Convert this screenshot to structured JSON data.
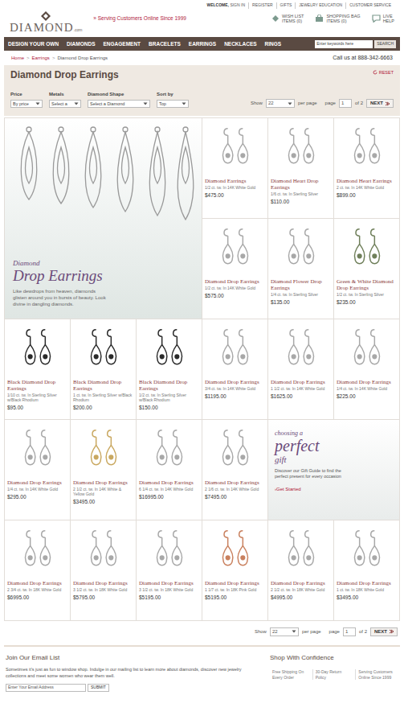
{
  "header": {
    "logo": "DIAMOND",
    "logo_suffix": ".com",
    "tagline": "» Serving Customers Online Since 1999",
    "top_links": [
      {
        "label": "WELCOME,",
        "bold": true,
        "extra": "SIGN IN"
      },
      {
        "label": "REGISTER",
        "bold": false,
        "extra": ""
      },
      {
        "label": "GIFTS",
        "bold": false,
        "extra": ""
      },
      {
        "label": "JEWELRY EDUCATION",
        "bold": false,
        "extra": ""
      },
      {
        "label": "CUSTOMER SERVICE",
        "bold": false,
        "extra": ""
      }
    ],
    "utilities": [
      {
        "label": "WISH LIST",
        "sub": "ITEMS (0)",
        "kind": "wishlist"
      },
      {
        "label": "SHOPPING BAG",
        "sub": "ITEMS (0)",
        "kind": "bag"
      },
      {
        "label": "LIVE",
        "sub": "HELP",
        "kind": "help"
      }
    ]
  },
  "nav": {
    "items": [
      "DESIGN YOUR OWN",
      "DIAMONDS",
      "ENGAGEMENT",
      "BRACELETS",
      "EARRINGS",
      "NECKLACES",
      "RINGS"
    ],
    "search_placeholder": "Enter keywords here",
    "search_button": "SEARCH"
  },
  "breadcrumb": {
    "items": [
      "Home",
      "Earrings",
      "Diamond Drop Earrings"
    ],
    "separator": ">",
    "phone": "Call us at 888-342-6663"
  },
  "page_title": "Diamond Drop Earrings",
  "reset": "RESET",
  "filters": [
    {
      "label": "Price",
      "value": "By price"
    },
    {
      "label": "Metals",
      "value": "Select a"
    },
    {
      "label": "Diamond Shape",
      "value": "Select a Diamond"
    },
    {
      "label": "Sort by",
      "value": "Top"
    }
  ],
  "pagination": {
    "show": "Show",
    "per_page_value": "22",
    "per_page": "per page",
    "page": "page",
    "current": "1",
    "of": "of 2",
    "next": "NEXT"
  },
  "hero": {
    "kicker": "Diamond",
    "title": "Drop Earrings",
    "text": "Like dewdrops from heaven, diamonds glisten around you in bursts of beauty. Look divine in dangling diamonds."
  },
  "promo": {
    "kicker": "choosing a",
    "title": "perfect",
    "title2": "gift",
    "text": "Discover our Gift Guide to find the perfect present for every occasion",
    "link": "›Get Started"
  },
  "products": [
    {
      "name": "Diamond Earrings",
      "desc": "1/2 ct. tw. In 14K White Gold",
      "price": "$475.00",
      "color": "#a8a8a8"
    },
    {
      "name": "Diamond Heart Drop Earrings",
      "desc": "1/6 ct. tw. In Sterling Silver",
      "price": "$110.00",
      "color": "#a8a8a8"
    },
    {
      "name": "Diamond Heart Earrings",
      "desc": "2 ct. tw. In 14K White Gold",
      "price": "$899.00",
      "color": "#a8a8a8"
    },
    {
      "name": "Diamond Drop Earrings",
      "desc": "1/2 ct. tw. In 14K White Gold",
      "price": "$575.00",
      "color": "#a8a8a8"
    },
    {
      "name": "Diamond Flower Drop Earrings",
      "desc": "1/4 ct. tw. In Sterling Silver",
      "price": "$135.00",
      "color": "#a8a8a8"
    },
    {
      "name": "Green & White Diamond Drop Earrings",
      "desc": "1/2 ct. tw. In Sterling Silver",
      "price": "$235.00",
      "color": "#6f7f5a"
    },
    {
      "name": "Black Diamond Drop Earrings",
      "desc": "1/10 ct. tw. In Sterling Silver w/Black Rhodium",
      "price": "$95.00",
      "color": "#2a2a2a"
    },
    {
      "name": "Black Diamond Drop Earrings",
      "desc": "1 ct. tw. In Sterling Silver w/Black Rhodium",
      "price": "$200.00",
      "color": "#2a2a2a"
    },
    {
      "name": "Black Diamond Drop Earrings",
      "desc": "1/2 ct. tw. In Sterling Silver w/Black Rhodium",
      "price": "$150.00",
      "color": "#2a2a2a"
    },
    {
      "name": "Diamond Drop Earrings",
      "desc": "3/4 ct. tw. In 14K White Gold",
      "price": "$1195.00",
      "color": "#a8a8a8"
    },
    {
      "name": "Diamond Drop Earrings",
      "desc": "1 1/2 ct. tw. In 14K White Gold",
      "price": "$1625.00",
      "color": "#a8a8a8"
    },
    {
      "name": "Diamond Drop Earrings",
      "desc": "1/4 ct. tw. In 14K White Gold",
      "price": "$225.00",
      "color": "#a8a8a8"
    },
    {
      "name": "Diamond Drop Earrings",
      "desc": "1/4 ct. tw. In 14K White Gold",
      "price": "$295.00",
      "color": "#a8a8a8"
    },
    {
      "name": "Diamond Drop Earrings",
      "desc": "2 1/2 ct. tw. In 14K White & Yellow Gold",
      "price": "$3495.00",
      "color": "#c9a860"
    },
    {
      "name": "Diamond Drop Earrings",
      "desc": "6 1/4 ct. tw. In 14K White Gold",
      "price": "$16995.00",
      "color": "#a8a8a8"
    },
    {
      "name": "Diamond Drop Earrings",
      "desc": "2 1/6 ct. tw. In 14K White Gold",
      "price": "$7495.00",
      "color": "#a8a8a8"
    },
    {
      "name": "Diamond Drop Earrings",
      "desc": "2 3/4 ct. tw. In 18K White Gold",
      "price": "$6995.00",
      "color": "#a8a8a8"
    },
    {
      "name": "Diamond Drop Earrings",
      "desc": "3 1/2 ct. tw. In 18K White Gold",
      "price": "$5795.00",
      "color": "#a8a8a8"
    },
    {
      "name": "Diamond Drop Earrings",
      "desc": "3 1/2 ct. tw. In 18K White Gold",
      "price": "$5195.00",
      "color": "#a8a8a8"
    },
    {
      "name": "Diamond Drop Earrings",
      "desc": "1 1/7 ct. tw. In 18K Pink Gold",
      "price": "$5195.00",
      "color": "#c9805e"
    },
    {
      "name": "Diamond Drop Earrings",
      "desc": "2 1/2 ct. tw. In 18K White Gold",
      "price": "$4995.00",
      "color": "#a8a8a8"
    },
    {
      "name": "Diamond Drop Earrings",
      "desc": "1 ct. tw. In 18K White Gold",
      "price": "$3495.00",
      "color": "#a8a8a8"
    }
  ],
  "footer": {
    "email_title": "Join Our Email List",
    "email_text": "Sometimes it's just as fun to window shop. Indulge in our mailing list to learn more about diamonds, discover new jewelry collections and meet some women who wear them well.",
    "email_placeholder": "Enter Your Email Address",
    "submit": "SUBMIT",
    "confidence_title": "Shop With Confidence",
    "confidence_items": [
      "Free Shipping On Every Order",
      "30-Day Return Policy",
      "Serving Customers Online Since 1999"
    ]
  }
}
